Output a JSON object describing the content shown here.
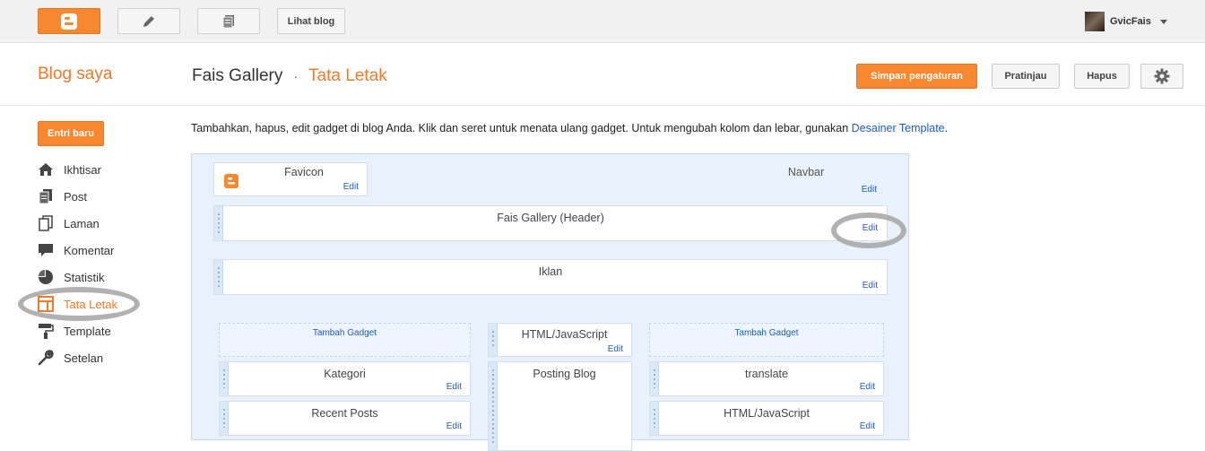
{
  "topbar": {
    "view_blog": "Lihat blog",
    "user_name": "GvicFais"
  },
  "header": {
    "my_blogs": "Blog saya",
    "blog_name": "Fais Gallery",
    "separator": "·",
    "current_page": "Tata Letak",
    "save_label": "Simpan pengaturan",
    "preview_label": "Pratinjau",
    "delete_label": "Hapus"
  },
  "sidebar": {
    "new_post": "Entri baru",
    "items": [
      {
        "label": "Ikhtisar",
        "icon": "home-icon"
      },
      {
        "label": "Post",
        "icon": "posts-icon"
      },
      {
        "label": "Laman",
        "icon": "pages-icon"
      },
      {
        "label": "Komentar",
        "icon": "comment-icon"
      },
      {
        "label": "Statistik",
        "icon": "pie-chart-icon"
      },
      {
        "label": "Tata Letak",
        "icon": "layout-icon",
        "active": true
      },
      {
        "label": "Template",
        "icon": "paint-roller-icon"
      },
      {
        "label": "Setelan",
        "icon": "wrench-icon"
      }
    ]
  },
  "main": {
    "intro_text": "Tambahkan, hapus, edit gadget di blog Anda. Klik dan seret untuk menata ulang gadget. Untuk mengubah kolom dan lebar, gunakan ",
    "intro_link": "Desainer Template",
    "intro_end": ".",
    "edit_label": "Edit",
    "add_gadget": "Tambah Gadget",
    "gadgets": {
      "favicon": "Favicon",
      "navbar": "Navbar",
      "header": "Fais Gallery (Header)",
      "iklan": "Iklan",
      "left_1": "Kategori",
      "left_2": "Recent Posts",
      "center_1": "HTML/JavaScript",
      "center_2": "Posting Blog",
      "right_1": "translate",
      "right_2": "HTML/JavaScript"
    }
  },
  "colors": {
    "accent": "#f7882f",
    "link": "#1a5fb4",
    "layout_bg": "#e8f2fc"
  }
}
